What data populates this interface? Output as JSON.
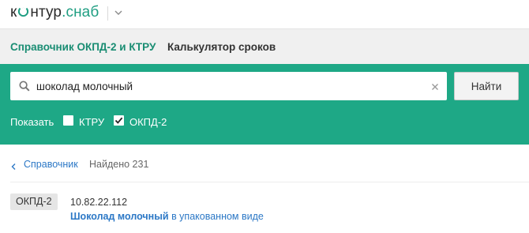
{
  "logo": {
    "text_before": "к",
    "text_after": "нтур",
    "suffix": ".снаб"
  },
  "nav": {
    "items": [
      {
        "label": "Справочник ОКПД-2 и КТРУ"
      },
      {
        "label": "Калькулятор сроков"
      }
    ]
  },
  "search": {
    "value": "шоколад молочный",
    "button_label": "Найти"
  },
  "filters": {
    "show_label": "Показать",
    "ktru": {
      "label": "КТРУ",
      "checked": false
    },
    "okpd": {
      "label": "ОКПД-2",
      "checked": true
    }
  },
  "breadcrumb": {
    "back_label": "Справочник",
    "found_text": "Найдено 231"
  },
  "results": [
    {
      "badge": "ОКПД-2",
      "code": "10.82.22.112",
      "title_bold": "Шоколад молочный",
      "title_rest": " в упакованном виде"
    }
  ],
  "colors": {
    "brand": "#1ea886",
    "link": "#2c78c6",
    "nav_active": "#1a8d73"
  },
  "icons": {
    "logo_cloud": "cloud-o-icon",
    "menu": "chevron-down-icon",
    "search": "search-icon",
    "clear": "close-icon",
    "checkbox": "check-icon",
    "back": "chevron-left-icon"
  }
}
